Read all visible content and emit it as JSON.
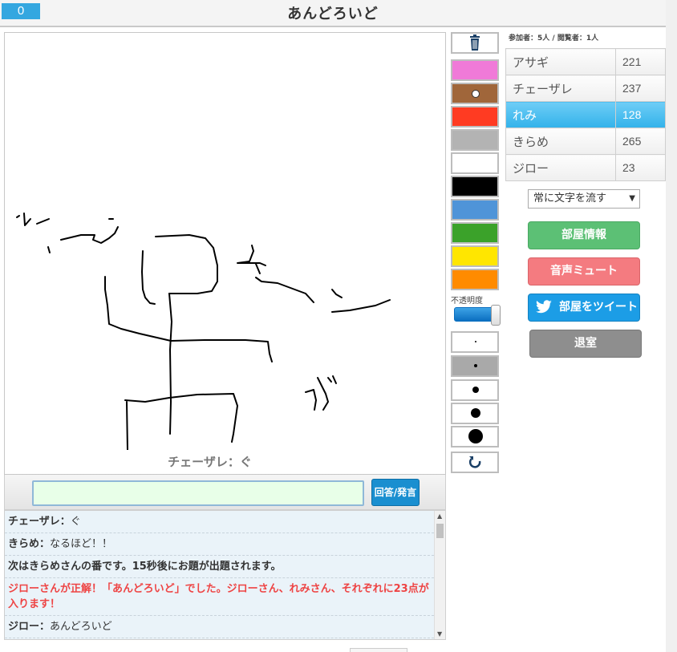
{
  "header": {
    "counter": "0",
    "title": "あんどろいど"
  },
  "canvas": {
    "drawer_caption": "チェーザレ：ぐ"
  },
  "answer": {
    "value": "",
    "placeholder": "",
    "button_label": "回答/発言"
  },
  "chat": {
    "lines": [
      {
        "name": "チェーザレ：",
        "text": "ぐ"
      },
      {
        "name": "きらめ：",
        "text": "なるほど！！"
      },
      {
        "text": "次はきらめさんの番です。15秒後にお題が出題されます。"
      },
      {
        "text": "ジローさんが正解！「あんどろいど」でした。ジローさん、れみさん、それぞれに23点が入ります！"
      },
      {
        "name": "ジロー：",
        "text": "あんどろいど"
      }
    ]
  },
  "tools": {
    "trash_icon": "trash-icon",
    "colors": [
      "#f07ad8",
      "#a0663a",
      "#ff3b22",
      "#b3b3b3",
      "#ffffff",
      "#000000",
      "#4f94d8",
      "#3ba22a",
      "#ffe600",
      "#ff8b00"
    ],
    "selected_color": "#a0663a",
    "opacity_label": "不透明度",
    "opacity": 0.95,
    "brush_sizes": [
      "xs",
      "s",
      "m",
      "l",
      "xl"
    ],
    "selected_size": "s",
    "undo_icon": "undo-icon"
  },
  "players": {
    "participants_label": "参加者：5人 / 閲覧者：1人",
    "list": [
      {
        "name": "アサギ",
        "score": "221"
      },
      {
        "name": "チェーザレ",
        "score": "237"
      },
      {
        "name": "れみ",
        "score": "128",
        "active": true
      },
      {
        "name": "きらめ",
        "score": "265"
      },
      {
        "name": "ジロー",
        "score": "23"
      }
    ]
  },
  "controls": {
    "text_flow_select": "常に文字を流す",
    "room_info": "部屋情報",
    "audio_mute": "音声ミュート",
    "tweet_room": "部屋をツイート",
    "leave": "退室"
  }
}
